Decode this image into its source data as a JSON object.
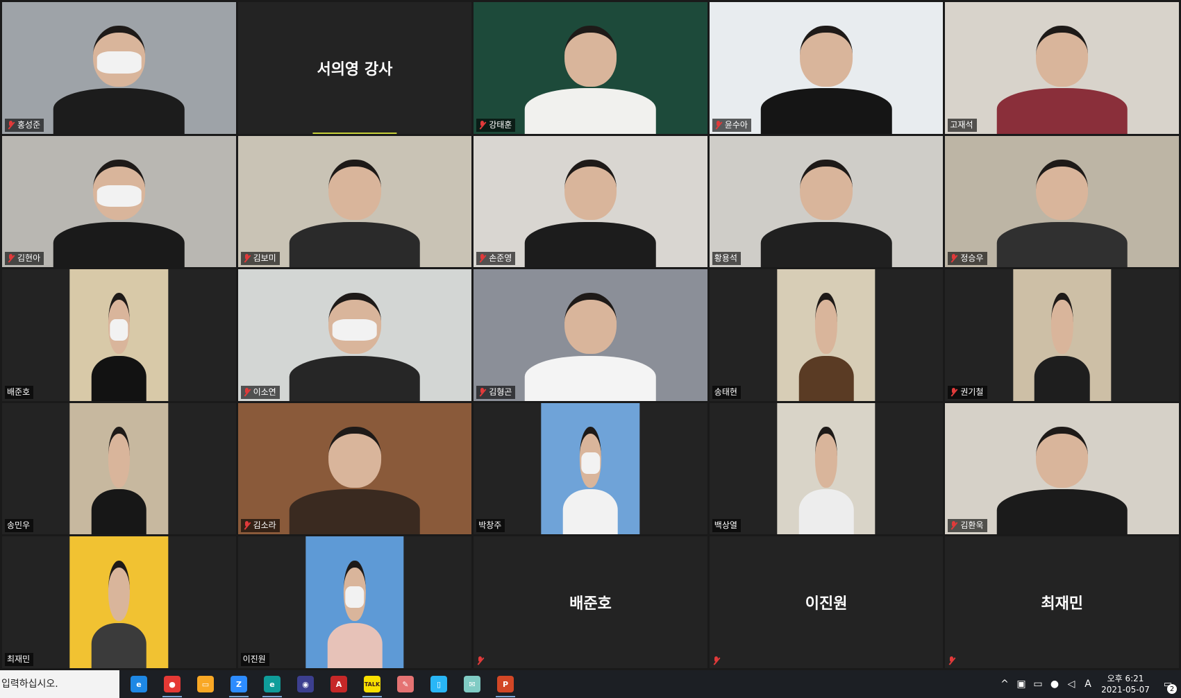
{
  "colors": {
    "tile_background": "#232323",
    "muted_mic": "#e03a3a",
    "active_speaker": "#c9d23a"
  },
  "tiles": [
    {
      "name": "홍성준",
      "muted": true,
      "bg": "#9ea3a8",
      "style": "full",
      "mask": true,
      "shirt": "#1c1c1c"
    },
    {
      "name": "서의영 강사",
      "muted": false,
      "style": "nameonly",
      "active": true
    },
    {
      "name": "강태훈",
      "muted": true,
      "bg": "#1d4a3a",
      "style": "full",
      "mask": false,
      "shirt": "#f1f1ee"
    },
    {
      "name": "윤수아",
      "muted": true,
      "bg": "#e8ecef",
      "style": "full",
      "mask": false,
      "shirt": "#151515"
    },
    {
      "name": "고재석",
      "muted": false,
      "bg": "#d8d3cb",
      "style": "full",
      "mask": false,
      "shirt": "#8a2f3a"
    },
    {
      "name": "김현아",
      "muted": true,
      "bg": "#b9b7b2",
      "style": "full",
      "mask": true,
      "shirt": "#1a1a1a"
    },
    {
      "name": "김보미",
      "muted": true,
      "bg": "#c9c3b5",
      "style": "full",
      "mask": false,
      "shirt": "#2a2a2a"
    },
    {
      "name": "손준영",
      "muted": true,
      "bg": "#d9d6d1",
      "style": "full",
      "mask": false,
      "shirt": "#1c1c1c"
    },
    {
      "name": "황용석",
      "muted": false,
      "bg": "#cfcdc8",
      "style": "full",
      "mask": false,
      "shirt": "#202020"
    },
    {
      "name": "정승우",
      "muted": true,
      "bg": "#bdb5a5",
      "style": "full",
      "mask": false,
      "shirt": "#303030"
    },
    {
      "name": "배준호",
      "muted": false,
      "bg": "#d8c9a8",
      "style": "center",
      "mask": true,
      "shirt": "#121212"
    },
    {
      "name": "이소연",
      "muted": true,
      "bg": "#d3d6d4",
      "style": "full",
      "mask": true,
      "shirt": "#262626"
    },
    {
      "name": "김형곤",
      "muted": true,
      "bg": "#8b8f98",
      "style": "full",
      "mask": false,
      "shirt": "#f4f4f4"
    },
    {
      "name": "송태현",
      "muted": false,
      "bg": "#d7cdb6",
      "style": "center",
      "mask": false,
      "shirt": "#5a3b24"
    },
    {
      "name": "권기철",
      "muted": true,
      "bg": "#cdbfa6",
      "style": "center",
      "mask": false,
      "shirt": "#1e1e1e"
    },
    {
      "name": "송민우",
      "muted": false,
      "bg": "#c7b89f",
      "style": "center",
      "mask": false,
      "shirt": "#171717"
    },
    {
      "name": "김소라",
      "muted": true,
      "bg": "#8a5a3a",
      "style": "full",
      "mask": false,
      "shirt": "#3a2a20"
    },
    {
      "name": "박창주",
      "muted": false,
      "bg": "#6fa3d8",
      "style": "center",
      "mask": true,
      "shirt": "#f2f2f2"
    },
    {
      "name": "백상열",
      "muted": false,
      "bg": "#d9d4c8",
      "style": "center",
      "mask": false,
      "shirt": "#ededed"
    },
    {
      "name": "김환욱",
      "muted": true,
      "bg": "#d6d1c8",
      "style": "full",
      "mask": false,
      "shirt": "#1b1b1b"
    },
    {
      "name": "최재민",
      "muted": false,
      "bg": "#f1c232",
      "style": "center",
      "mask": false,
      "shirt": "#3b3b3b"
    },
    {
      "name": "이진원",
      "muted": false,
      "bg": "#5e9ad6",
      "style": "center",
      "mask": true,
      "shirt": "#e7c2b8"
    },
    {
      "name": "배준호",
      "muted": true,
      "style": "nameonly",
      "active": false
    },
    {
      "name": "이진원",
      "muted": true,
      "style": "nameonly",
      "active": false
    },
    {
      "name": "최재민",
      "muted": true,
      "style": "nameonly",
      "active": false
    }
  ],
  "taskbar": {
    "search_text": "입력하십시오.",
    "apps": [
      {
        "icon": "internet-explorer-icon",
        "label": "e",
        "color": "#1e88e5",
        "open": false
      },
      {
        "icon": "chrome-icon",
        "label": "●",
        "color": "#e53935",
        "open": true
      },
      {
        "icon": "file-explorer-icon",
        "label": "▭",
        "color": "#f9a825",
        "open": false
      },
      {
        "icon": "zoom-icon",
        "label": "Z",
        "color": "#2d8cff",
        "open": true
      },
      {
        "icon": "edge-icon",
        "label": "e",
        "color": "#0f9d9a",
        "open": true
      },
      {
        "icon": "eclipse-icon",
        "label": "◉",
        "color": "#3c3f8f",
        "open": false
      },
      {
        "icon": "acrobat-icon",
        "label": "A",
        "color": "#c62828",
        "open": false
      },
      {
        "icon": "kakaotalk-icon",
        "label": "TALK",
        "color": "#f9e000",
        "open": true
      },
      {
        "icon": "paint-icon",
        "label": "✎",
        "color": "#e57373",
        "open": false
      },
      {
        "icon": "notepad-icon",
        "label": "▯",
        "color": "#29b6f6",
        "open": false
      },
      {
        "icon": "notes-icon",
        "label": "✉",
        "color": "#80cbc4",
        "open": false
      },
      {
        "icon": "powerpoint-icon",
        "label": "P",
        "color": "#d24726",
        "open": true
      }
    ],
    "tray": {
      "chevron": "^",
      "ime": "A",
      "time": "오후 6:21",
      "date": "2021-05-07",
      "notification_count": "2"
    }
  }
}
